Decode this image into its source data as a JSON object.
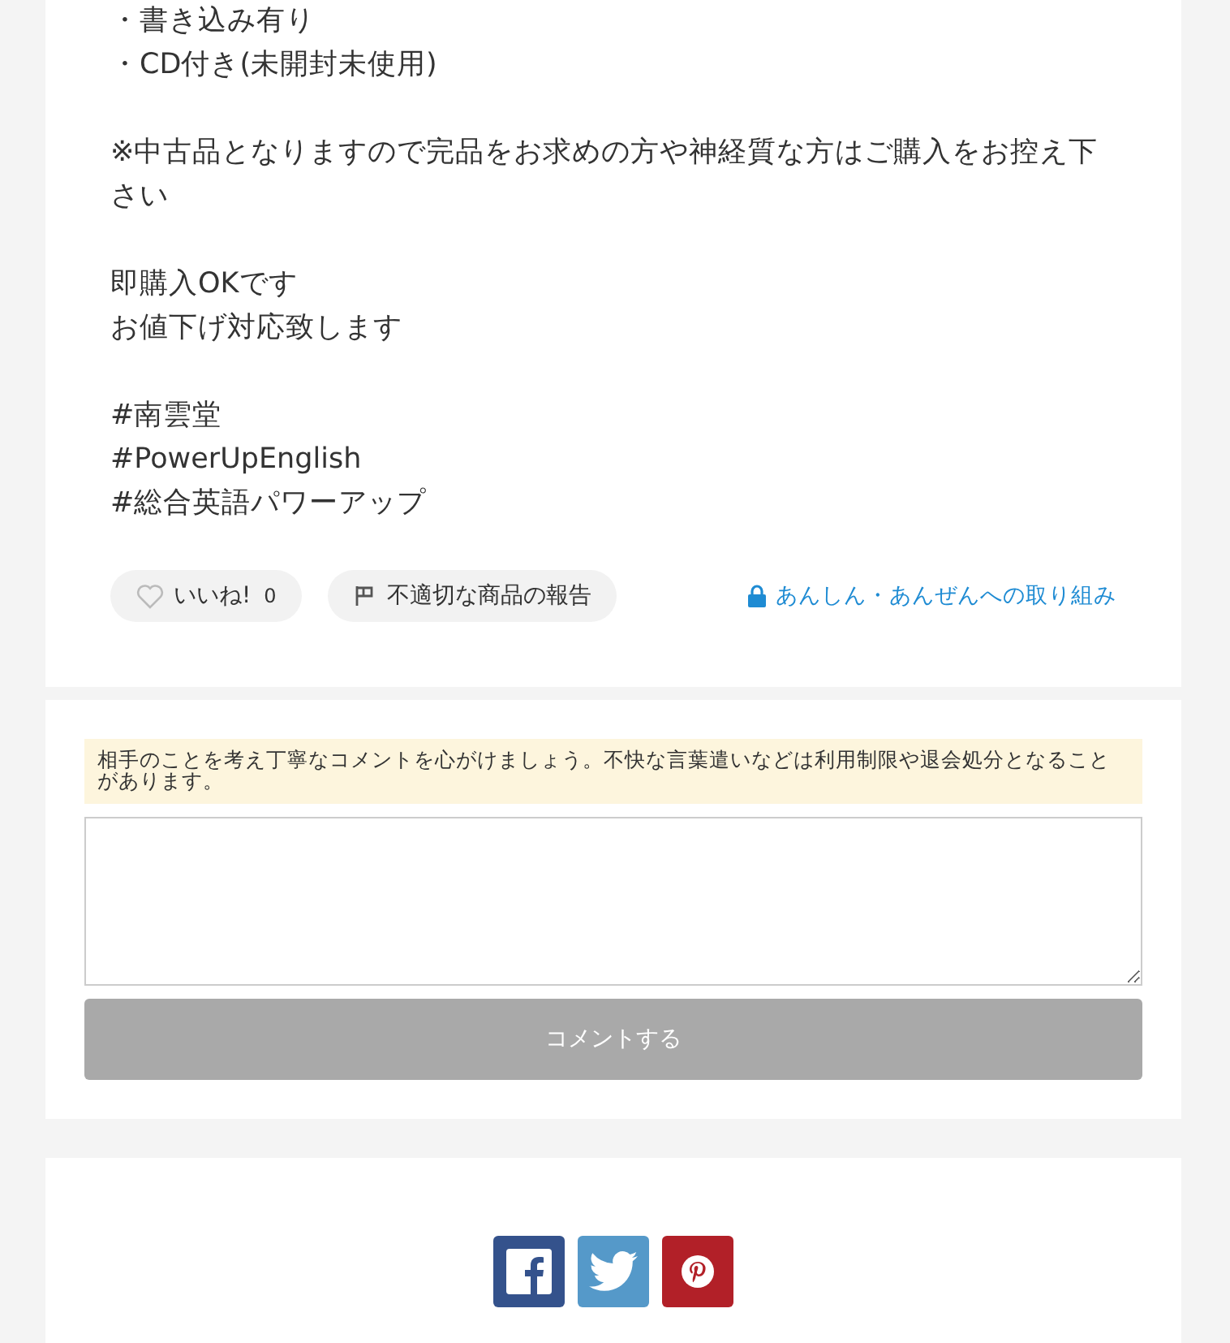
{
  "description": {
    "paragraphs": [
      {
        "lines": [
          "・書き込み有り",
          "・CD付き(未開封未使用)"
        ]
      },
      {
        "lines": [
          "※中古品となりますので完品をお求めの方や神経質な方はご購入をお控え下さい"
        ]
      },
      {
        "lines": [
          "即購入OKです",
          "お値下げ対応致します"
        ]
      },
      {
        "lines": [
          "#南雲堂",
          "#PowerUpEnglish",
          "#総合英語パワーアップ"
        ]
      }
    ]
  },
  "actions": {
    "like": {
      "label": "いいね!",
      "count": "0",
      "liked": false
    },
    "report": {
      "label": "不適切な商品の報告"
    },
    "safety_link": {
      "label": "あんしん・あんぜんへの取り組み"
    }
  },
  "comment": {
    "notice": "相手のことを考え丁寧なコメントを心がけましょう。不快な言葉遣いなどは利用制限や退会処分となることがあります。",
    "submit": {
      "label": "コメントする",
      "disabled": true
    }
  },
  "share": [
    {
      "kind": "facebook"
    },
    {
      "kind": "twitter"
    },
    {
      "kind": "pinterest"
    }
  ]
}
